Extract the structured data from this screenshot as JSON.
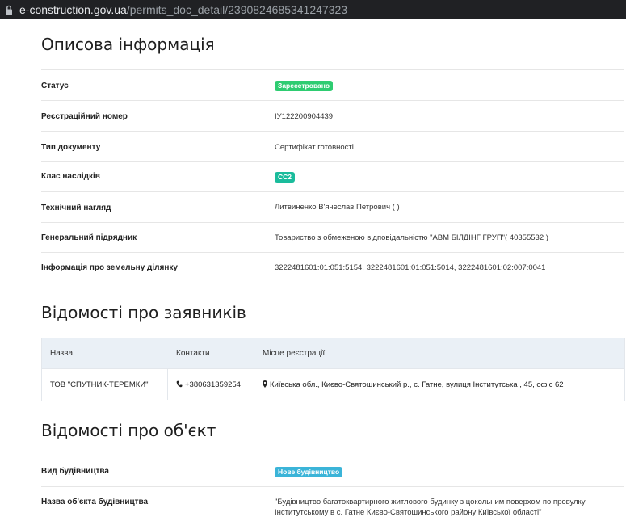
{
  "browser": {
    "url_domain": "e-construction.gov.ua",
    "url_path": "/permits_doc_detail/2390824685341247323"
  },
  "colors": {
    "status_green": "#2ecc71",
    "cc_teal": "#1abc9c",
    "new_build_blue": "#3bb4d8",
    "table_header_bg": "#eaf0f6"
  },
  "description": {
    "title": "Описова інформація",
    "rows": [
      {
        "label": "Статус",
        "value": "Зареєстровано",
        "badge": true
      },
      {
        "label": "Реєстраційний номер",
        "value": "ІУ122200904439"
      },
      {
        "label": "Тип документу",
        "value": "Сертифікат готовності"
      },
      {
        "label": "Клас наслідків",
        "value": "СС2",
        "badge": true
      },
      {
        "label": "Технічний нагляд",
        "value": "Литвиненко В'ячеслав Петрович ( )"
      },
      {
        "label": "Генеральний підрядник",
        "value": "Товариство з обмеженою відповідальністю \"АВМ БІЛДІНГ ГРУП\"( 40355532 )"
      },
      {
        "label": "Інформація про земельну ділянку",
        "value": "3222481601:01:051:5154, 3222481601:01:051:5014, 3222481601:02:007:0041"
      }
    ]
  },
  "applicants": {
    "title": "Відомості про заявників",
    "columns": [
      "Назва",
      "Контакти",
      "Місце реєстрації"
    ],
    "rows": [
      {
        "name": "ТОВ \"СПУТНИК-ТЕРЕМКИ\"",
        "phone": "+380631359254",
        "address": "Київська обл., Києво-Святошинський р., с. Гатне, вулиця Інститутська , 45, офіс 62",
        "phone_icon": "phone-icon",
        "address_icon": "map-marker-icon"
      }
    ]
  },
  "object": {
    "title": "Відомості про об'єкт",
    "rows": [
      {
        "label": "Вид будівництва",
        "value": "Нове будівництво",
        "badge": true
      },
      {
        "label": "Назва об'єкта будівництва",
        "value": "\"Будівництво багатоквартирного житлового будинку з цокольним поверхом по провулку Інститутському в с. Гатне Києво-Святошинського району Київської області\""
      }
    ]
  }
}
